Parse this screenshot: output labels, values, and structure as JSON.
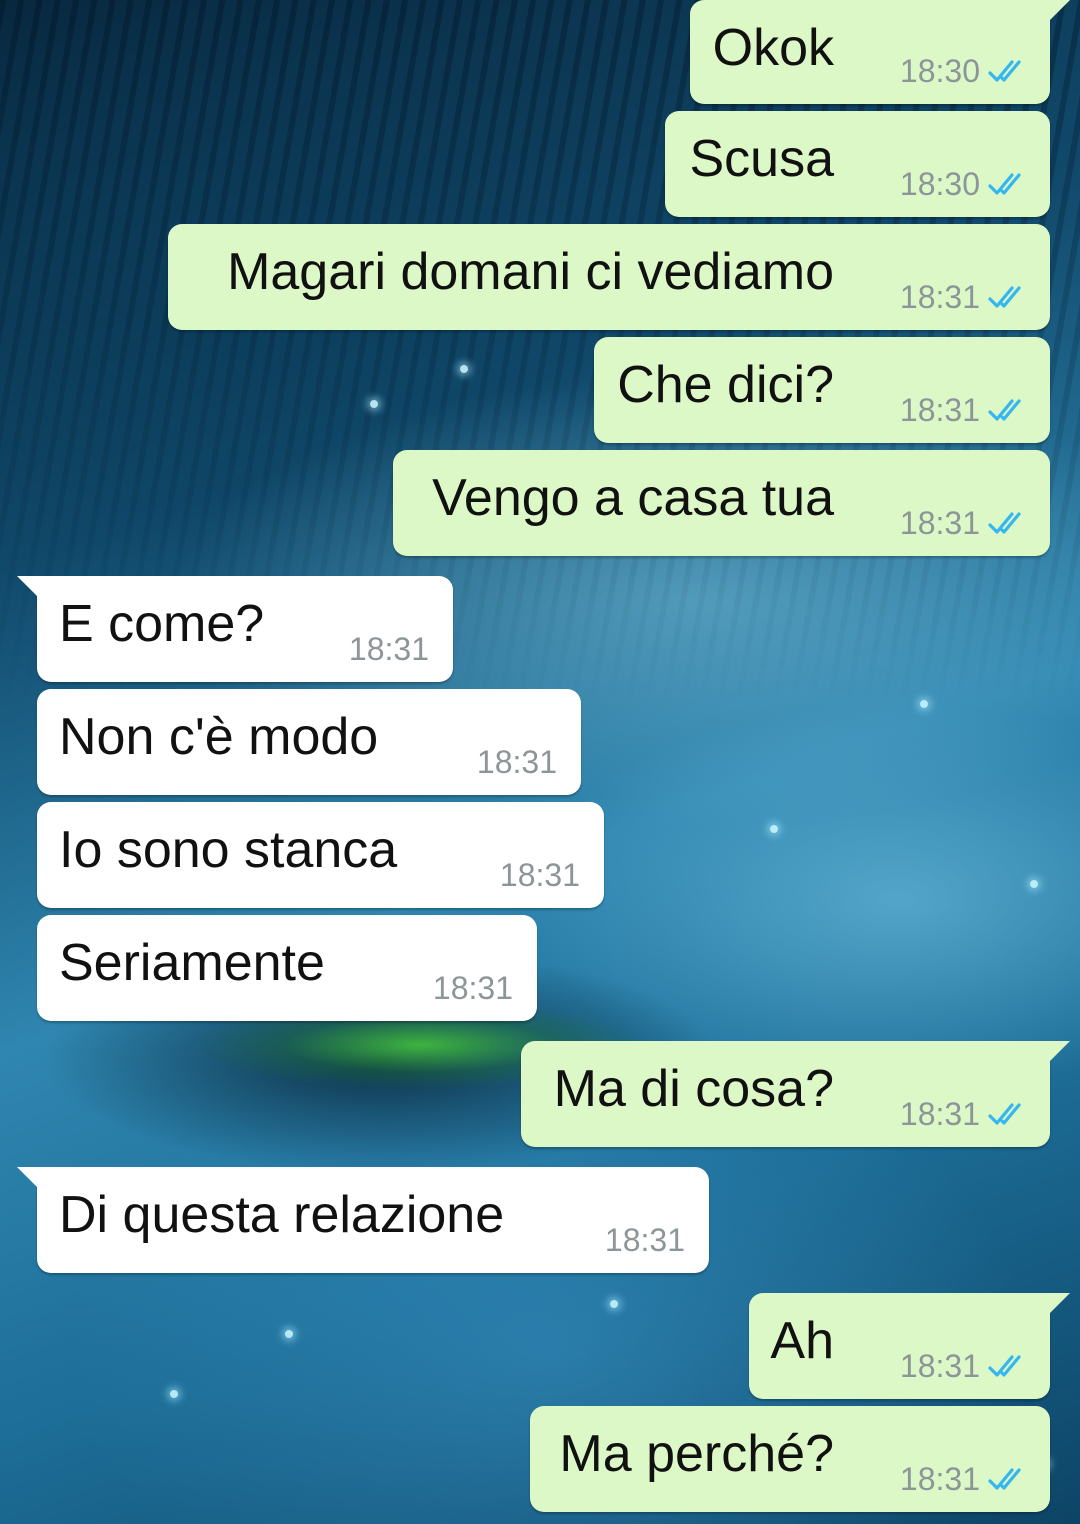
{
  "conversation": {
    "messages": [
      {
        "direction": "out",
        "text": "Okok",
        "time": "18:30",
        "status": "read"
      },
      {
        "direction": "out",
        "text": "Scusa",
        "time": "18:30",
        "status": "read"
      },
      {
        "direction": "out",
        "text": "Magari domani ci vediamo",
        "time": "18:31",
        "status": "read"
      },
      {
        "direction": "out",
        "text": "Che dici?",
        "time": "18:31",
        "status": "read"
      },
      {
        "direction": "out",
        "text": "Vengo a casa tua",
        "time": "18:31",
        "status": "read"
      },
      {
        "direction": "in",
        "text": "E come?",
        "time": "18:31"
      },
      {
        "direction": "in",
        "text": "Non c'è modo",
        "time": "18:31"
      },
      {
        "direction": "in",
        "text": "Io sono stanca",
        "time": "18:31"
      },
      {
        "direction": "in",
        "text": "Seriamente",
        "time": "18:31"
      },
      {
        "direction": "out",
        "text": "Ma di cosa?",
        "time": "18:31",
        "status": "read"
      },
      {
        "direction": "in",
        "text": "Di questa relazione",
        "time": "18:31"
      },
      {
        "direction": "out",
        "text": "Ah",
        "time": "18:31",
        "status": "read"
      },
      {
        "direction": "out",
        "text": "Ma perché?",
        "time": "18:31",
        "status": "read"
      }
    ]
  },
  "icons": {
    "read_receipt": "double-check-icon"
  },
  "colors": {
    "outgoing_bubble": "#dcf8c6",
    "incoming_bubble": "#ffffff",
    "read_ticks": "#34b7f1",
    "timestamp": "#8c9598",
    "wallpaper_base": "#1d6e98"
  }
}
